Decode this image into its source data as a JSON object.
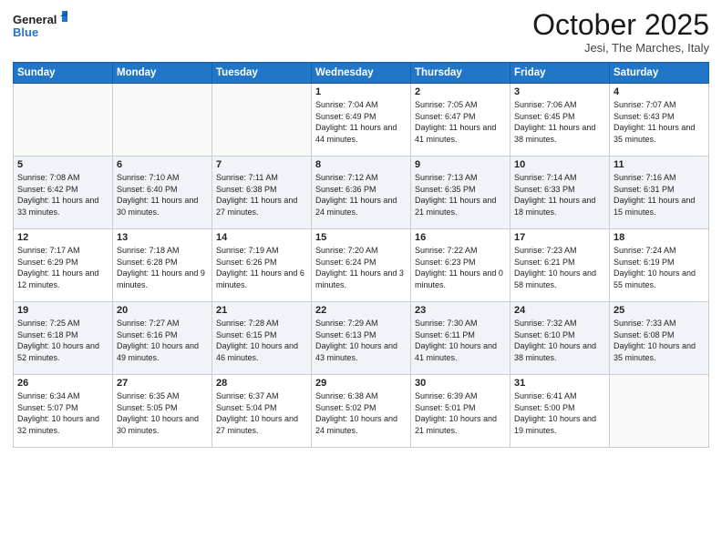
{
  "logo": {
    "line1": "General",
    "line2": "Blue"
  },
  "header": {
    "month": "October 2025",
    "location": "Jesi, The Marches, Italy"
  },
  "weekdays": [
    "Sunday",
    "Monday",
    "Tuesday",
    "Wednesday",
    "Thursday",
    "Friday",
    "Saturday"
  ],
  "weeks": [
    [
      {
        "day": "",
        "text": ""
      },
      {
        "day": "",
        "text": ""
      },
      {
        "day": "",
        "text": ""
      },
      {
        "day": "1",
        "text": "Sunrise: 7:04 AM\nSunset: 6:49 PM\nDaylight: 11 hours and 44 minutes."
      },
      {
        "day": "2",
        "text": "Sunrise: 7:05 AM\nSunset: 6:47 PM\nDaylight: 11 hours and 41 minutes."
      },
      {
        "day": "3",
        "text": "Sunrise: 7:06 AM\nSunset: 6:45 PM\nDaylight: 11 hours and 38 minutes."
      },
      {
        "day": "4",
        "text": "Sunrise: 7:07 AM\nSunset: 6:43 PM\nDaylight: 11 hours and 35 minutes."
      }
    ],
    [
      {
        "day": "5",
        "text": "Sunrise: 7:08 AM\nSunset: 6:42 PM\nDaylight: 11 hours and 33 minutes."
      },
      {
        "day": "6",
        "text": "Sunrise: 7:10 AM\nSunset: 6:40 PM\nDaylight: 11 hours and 30 minutes."
      },
      {
        "day": "7",
        "text": "Sunrise: 7:11 AM\nSunset: 6:38 PM\nDaylight: 11 hours and 27 minutes."
      },
      {
        "day": "8",
        "text": "Sunrise: 7:12 AM\nSunset: 6:36 PM\nDaylight: 11 hours and 24 minutes."
      },
      {
        "day": "9",
        "text": "Sunrise: 7:13 AM\nSunset: 6:35 PM\nDaylight: 11 hours and 21 minutes."
      },
      {
        "day": "10",
        "text": "Sunrise: 7:14 AM\nSunset: 6:33 PM\nDaylight: 11 hours and 18 minutes."
      },
      {
        "day": "11",
        "text": "Sunrise: 7:16 AM\nSunset: 6:31 PM\nDaylight: 11 hours and 15 minutes."
      }
    ],
    [
      {
        "day": "12",
        "text": "Sunrise: 7:17 AM\nSunset: 6:29 PM\nDaylight: 11 hours and 12 minutes."
      },
      {
        "day": "13",
        "text": "Sunrise: 7:18 AM\nSunset: 6:28 PM\nDaylight: 11 hours and 9 minutes."
      },
      {
        "day": "14",
        "text": "Sunrise: 7:19 AM\nSunset: 6:26 PM\nDaylight: 11 hours and 6 minutes."
      },
      {
        "day": "15",
        "text": "Sunrise: 7:20 AM\nSunset: 6:24 PM\nDaylight: 11 hours and 3 minutes."
      },
      {
        "day": "16",
        "text": "Sunrise: 7:22 AM\nSunset: 6:23 PM\nDaylight: 11 hours and 0 minutes."
      },
      {
        "day": "17",
        "text": "Sunrise: 7:23 AM\nSunset: 6:21 PM\nDaylight: 10 hours and 58 minutes."
      },
      {
        "day": "18",
        "text": "Sunrise: 7:24 AM\nSunset: 6:19 PM\nDaylight: 10 hours and 55 minutes."
      }
    ],
    [
      {
        "day": "19",
        "text": "Sunrise: 7:25 AM\nSunset: 6:18 PM\nDaylight: 10 hours and 52 minutes."
      },
      {
        "day": "20",
        "text": "Sunrise: 7:27 AM\nSunset: 6:16 PM\nDaylight: 10 hours and 49 minutes."
      },
      {
        "day": "21",
        "text": "Sunrise: 7:28 AM\nSunset: 6:15 PM\nDaylight: 10 hours and 46 minutes."
      },
      {
        "day": "22",
        "text": "Sunrise: 7:29 AM\nSunset: 6:13 PM\nDaylight: 10 hours and 43 minutes."
      },
      {
        "day": "23",
        "text": "Sunrise: 7:30 AM\nSunset: 6:11 PM\nDaylight: 10 hours and 41 minutes."
      },
      {
        "day": "24",
        "text": "Sunrise: 7:32 AM\nSunset: 6:10 PM\nDaylight: 10 hours and 38 minutes."
      },
      {
        "day": "25",
        "text": "Sunrise: 7:33 AM\nSunset: 6:08 PM\nDaylight: 10 hours and 35 minutes."
      }
    ],
    [
      {
        "day": "26",
        "text": "Sunrise: 6:34 AM\nSunset: 5:07 PM\nDaylight: 10 hours and 32 minutes."
      },
      {
        "day": "27",
        "text": "Sunrise: 6:35 AM\nSunset: 5:05 PM\nDaylight: 10 hours and 30 minutes."
      },
      {
        "day": "28",
        "text": "Sunrise: 6:37 AM\nSunset: 5:04 PM\nDaylight: 10 hours and 27 minutes."
      },
      {
        "day": "29",
        "text": "Sunrise: 6:38 AM\nSunset: 5:02 PM\nDaylight: 10 hours and 24 minutes."
      },
      {
        "day": "30",
        "text": "Sunrise: 6:39 AM\nSunset: 5:01 PM\nDaylight: 10 hours and 21 minutes."
      },
      {
        "day": "31",
        "text": "Sunrise: 6:41 AM\nSunset: 5:00 PM\nDaylight: 10 hours and 19 minutes."
      },
      {
        "day": "",
        "text": ""
      }
    ]
  ]
}
